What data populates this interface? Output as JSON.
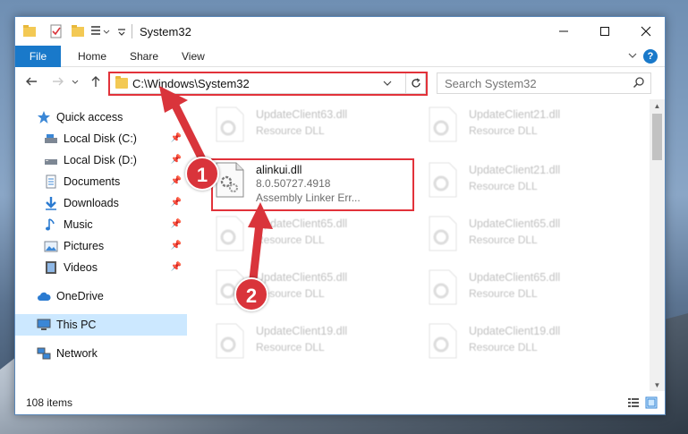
{
  "window": {
    "title": "System32"
  },
  "ribbon": {
    "tabs": [
      "File",
      "Home",
      "Share",
      "View"
    ],
    "help_label": "?"
  },
  "address_bar": {
    "path": "C:\\Windows\\System32"
  },
  "search": {
    "placeholder": "Search System32"
  },
  "nav_pane": {
    "quick_access": "Quick access",
    "items": [
      {
        "label": "Local Disk (C:)",
        "icon": "drive-icon",
        "pinned": true
      },
      {
        "label": "Local Disk (D:)",
        "icon": "drive-icon",
        "pinned": true
      },
      {
        "label": "Documents",
        "icon": "documents-icon",
        "pinned": true
      },
      {
        "label": "Downloads",
        "icon": "downloads-icon",
        "pinned": true
      },
      {
        "label": "Music",
        "icon": "music-icon",
        "pinned": true
      },
      {
        "label": "Pictures",
        "icon": "pictures-icon",
        "pinned": true
      },
      {
        "label": "Videos",
        "icon": "videos-icon",
        "pinned": true
      }
    ],
    "onedrive": "OneDrive",
    "this_pc": "This PC",
    "network": "Network"
  },
  "files": {
    "main": {
      "name": "alinkui.dll",
      "version": "8.0.50727.4918",
      "description": "Assembly Linker Err..."
    },
    "faded": [
      {
        "name": "UpdateClient63.dll",
        "desc": "Resource DLL"
      },
      {
        "name": "UpdateClient21.dll",
        "desc": "Resource DLL"
      },
      {
        "name": "UpdateClient21.dll",
        "desc": "Resource DLL"
      },
      {
        "name": "UpdateClient65.dll",
        "desc": "Resource DLL"
      },
      {
        "name": "UpdateClient65.dll",
        "desc": "Resource DLL"
      },
      {
        "name": "UpdateClient65.dll",
        "desc": "Resource DLL"
      },
      {
        "name": "UpdateClient65.dll",
        "desc": "Resource DLL"
      },
      {
        "name": "UpdateClient19.dll",
        "desc": "Resource DLL"
      },
      {
        "name": "UpdateClient19.dll",
        "desc": "Resource DLL"
      }
    ]
  },
  "status": {
    "item_count": "108 items"
  },
  "annotations": {
    "step1": "1",
    "step2": "2"
  },
  "colors": {
    "accent": "#1979ca",
    "highlight": "#e2323a",
    "selected": "#cce8ff"
  }
}
